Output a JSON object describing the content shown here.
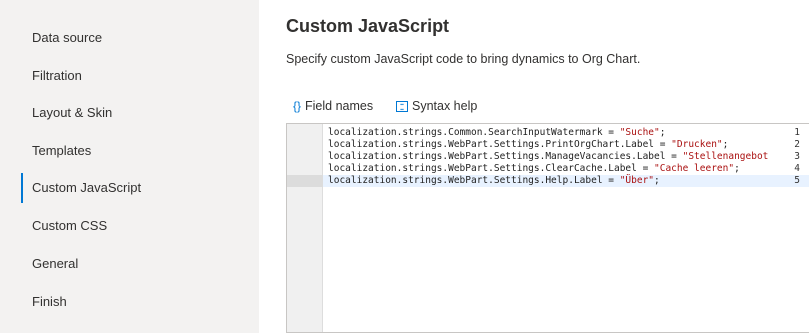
{
  "sidebar": {
    "items": [
      {
        "label": "Data source",
        "active": false
      },
      {
        "label": "Filtration",
        "active": false
      },
      {
        "label": "Layout & Skin",
        "active": false
      },
      {
        "label": "Templates",
        "active": false
      },
      {
        "label": "Custom JavaScript",
        "active": true
      },
      {
        "label": "Custom CSS",
        "active": false
      },
      {
        "label": "General",
        "active": false
      },
      {
        "label": "Finish",
        "active": false
      }
    ]
  },
  "main": {
    "title": "Custom JavaScript",
    "description": "Specify custom JavaScript code to bring dynamics to Org Chart.",
    "toolbar": {
      "field_names_icon": "{}",
      "field_names_label": "Field names",
      "syntax_help_label": "Syntax help"
    },
    "editor": {
      "lines": [
        {
          "number": "1",
          "code": "localization.strings.Common.SearchInputWatermark = ",
          "string": "\"Suche\"",
          "end": ";"
        },
        {
          "number": "2",
          "code": "localization.strings.WebPart.Settings.PrintOrgChart.Label = ",
          "string": "\"Drucken\"",
          "end": ";"
        },
        {
          "number": "3",
          "code": "localization.strings.WebPart.Settings.ManageVacancies.Label = ",
          "string": "\"Stellenangebot",
          "end": ""
        },
        {
          "number": "4",
          "code": "localization.strings.WebPart.Settings.ClearCache.Label = ",
          "string": "\"Cache leeren\"",
          "end": ";"
        },
        {
          "number": "5",
          "code": "localization.strings.WebPart.Settings.Help.Label = ",
          "string": "\"Über\"",
          "end": ";"
        }
      ]
    }
  },
  "colors": {
    "accent": "#0078d4",
    "sidebar_bg": "#f3f2f1",
    "string": "#aa1111"
  }
}
